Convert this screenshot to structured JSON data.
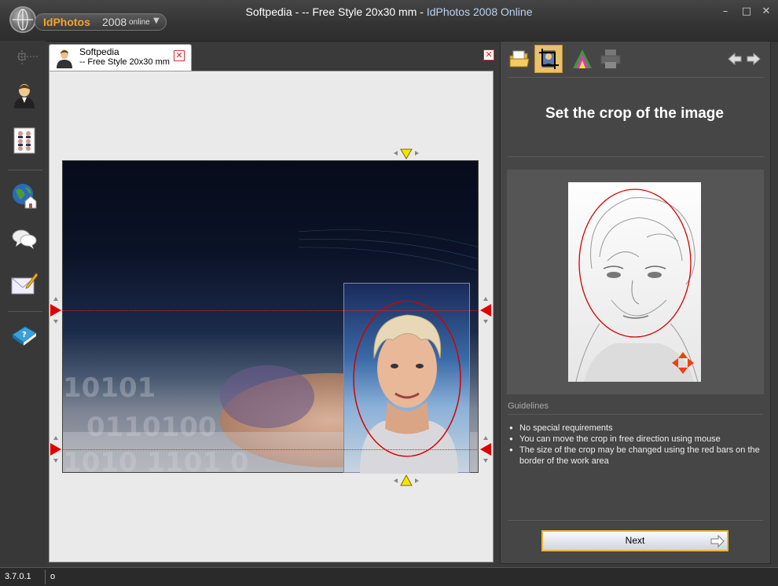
{
  "app": {
    "logo_text": "IdPhotos",
    "logo_year": "2008",
    "logo_sub": "online",
    "window_title_doc": "Softpedia - -- Free Style 20x30 mm - ",
    "window_title_app": "IdPhotos 2008 Online"
  },
  "window_controls": {
    "minimize": "–",
    "maximize": "□",
    "close": "✕"
  },
  "left_rail": {
    "items": [
      {
        "icon": "person-icon"
      },
      {
        "icon": "photo-sheet-icon"
      },
      {
        "icon": "globe-home-icon"
      },
      {
        "icon": "chat-bubbles-icon"
      },
      {
        "icon": "mail-pencil-icon"
      },
      {
        "icon": "help-book-icon"
      }
    ]
  },
  "document_tab": {
    "title": "Softpedia",
    "subtitle": "-- Free Style 20x30 mm",
    "close": "✕"
  },
  "workspace": {
    "close": "✕"
  },
  "toolbar": {
    "tools": [
      "open-folder-icon",
      "crop-icon",
      "color-icon",
      "printer-icon"
    ],
    "nav": [
      "back-arrow-icon",
      "forward-arrow-icon"
    ]
  },
  "panel": {
    "title": "Set the crop of the image",
    "guidelines_label": "Guidelines",
    "guidelines": [
      "No special requirements",
      "You can move the crop in free direction using mouse",
      "The size of the crop may be changed using the red bars on the border of the work area"
    ],
    "next_label": "Next"
  },
  "status": {
    "version": "3.7.0.1",
    "text": "o"
  },
  "colors": {
    "accent": "#f3a32a",
    "handle_red": "#e00000",
    "handle_yellow": "#f5e600"
  }
}
